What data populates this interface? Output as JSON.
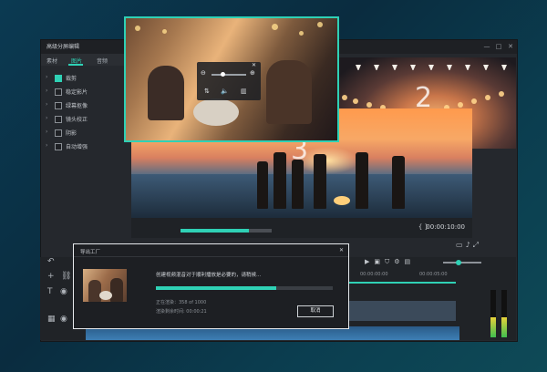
{
  "window": {
    "title": "高级分屏编辑",
    "controls": [
      "—",
      "□",
      "✕"
    ]
  },
  "tabs": [
    {
      "label": "素材",
      "active": false
    },
    {
      "label": "图片",
      "active": true
    },
    {
      "label": "音频",
      "active": false
    }
  ],
  "options": [
    {
      "label": "裁剪",
      "checked": true
    },
    {
      "label": "稳定影片",
      "checked": false
    },
    {
      "label": "绿幕抠像",
      "checked": false
    },
    {
      "label": "镜头校正",
      "checked": false
    },
    {
      "label": "阴影",
      "checked": false
    },
    {
      "label": "自动增强",
      "checked": false
    }
  ],
  "preview": {
    "label_3": "3",
    "label_2": "2",
    "timecode": "00:00:10:00",
    "brackets": "{  }",
    "progress": 0.75
  },
  "timeline": {
    "ruler_labels": [
      "00:00:00:00",
      "00:00:05:00"
    ]
  },
  "dialog": {
    "title": "导出工厂",
    "close": "✕",
    "message": "创建视频混音对于顺利播放是必要的，请稍候...",
    "progress": 0.68,
    "rendered": "正在渲染：358 of 1000",
    "remaining": "渲染剩余时间: 00:00:21",
    "cancel_label": "取消"
  },
  "colors": {
    "accent": "#2fd1b5",
    "window_bg": "#25282d"
  },
  "icons": [
    "chevron-right-icon",
    "play-icon",
    "volume-icon",
    "settings-icon",
    "trash-icon",
    "undo-icon",
    "plus-icon",
    "link-icon",
    "text-icon",
    "eye-icon",
    "film-icon",
    "fullscreen-icon",
    "camera-icon"
  ]
}
